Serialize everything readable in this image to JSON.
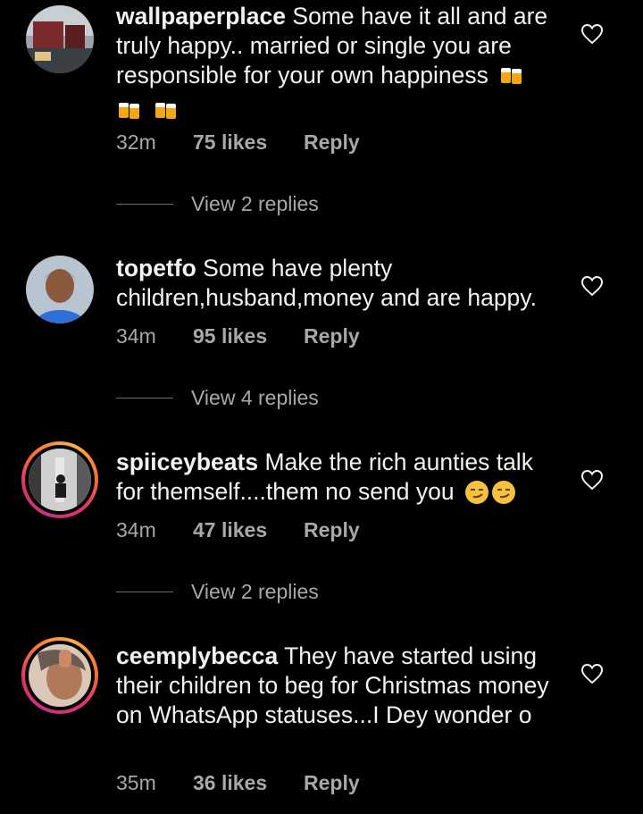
{
  "comments": [
    {
      "username": "wallpaperplace",
      "text": "Some have it all and are truly happy.. married or single you are responsible for your own happiness",
      "emojis": [
        "beer-mugs-emoji",
        "beer-mugs-emoji",
        "beer-mugs-emoji"
      ],
      "time": "32m",
      "likes": "75 likes",
      "reply": "Reply",
      "view_replies": "View 2 replies"
    },
    {
      "username": "topetfo",
      "text": "Some have plenty children,husband,money and are happy.",
      "time": "34m",
      "likes": "95 likes",
      "reply": "Reply",
      "view_replies": "View 4 replies"
    },
    {
      "username": "spiiceybeats",
      "text": "Make the rich aunties talk for themself....them no send you",
      "emojis": [
        "smirk-emoji",
        "smirk-emoji"
      ],
      "time": "34m",
      "likes": "47 likes",
      "reply": "Reply",
      "view_replies": "View 2 replies"
    },
    {
      "username": "ceemplybecca",
      "text": "They have started using their children to beg for Christmas money on WhatsApp statuses...I Dey wonder o",
      "time": "35m",
      "likes": "36 likes",
      "reply": "Reply"
    }
  ],
  "icons": {
    "like": "heart-outline-icon"
  },
  "colors": {
    "background": "#000000",
    "text": "#f2f2f2",
    "secondary": "#a8a8a8",
    "story_ring": "#e1306c"
  }
}
